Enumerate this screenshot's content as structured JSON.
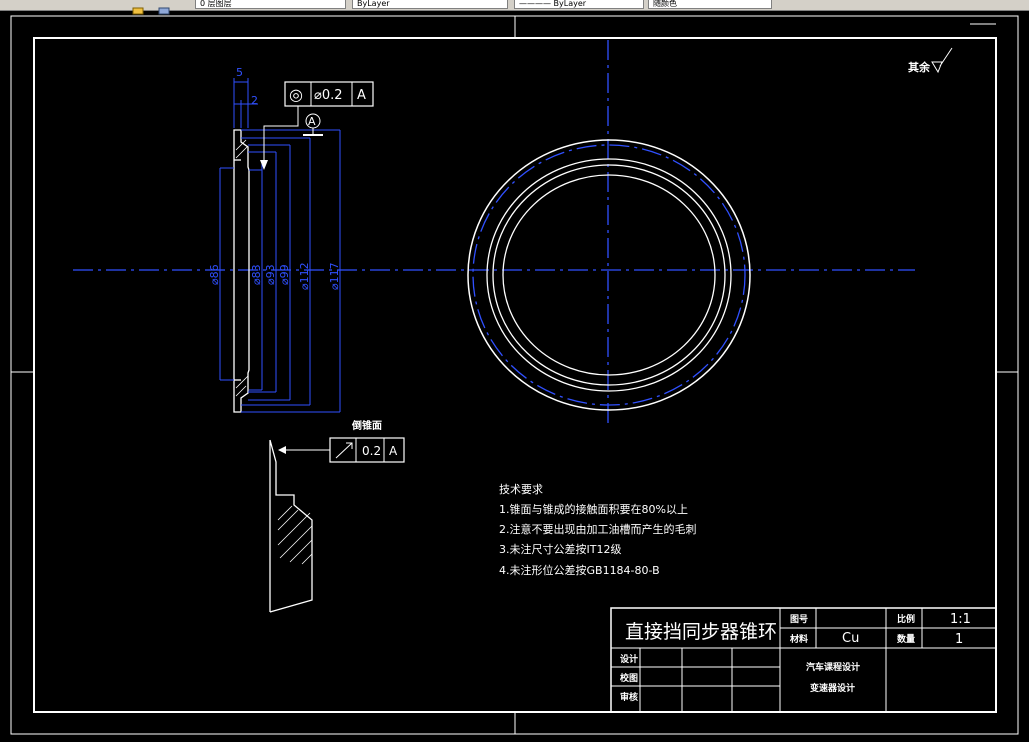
{
  "toolbar": {
    "layer_value": "0 层图层",
    "color_value": "ByLayer",
    "linetype_value": "———— ByLayer",
    "lineweight_value": "随颜色"
  },
  "drawing": {
    "roughness_other": "其余",
    "dimensions": {
      "top_width": "5",
      "top_step": "2",
      "d86": "⌀86",
      "d83": "⌀83",
      "d93": "⌀93",
      "d99": "⌀99",
      "d112": "⌀112",
      "d117": "⌀117"
    },
    "tolerance_concentricity": {
      "symbol": "◎",
      "value": "⌀0.2",
      "datum": "A"
    },
    "datum_label": "A",
    "section_title": "倒锥面",
    "tolerance_runout": {
      "symbol": "↗",
      "value": "0.2",
      "datum": "A"
    }
  },
  "requirements": {
    "title": "技术要求",
    "items": [
      "1.锥面与锥成的接触面积要在80%以上",
      "2.注意不要出现由加工油槽而产生的毛刺",
      "3.未注尺寸公差按IT12级",
      "4.未注形位公差按GB1184-80-B"
    ]
  },
  "title_block": {
    "part_name": "直接挡同步器锥环",
    "drawing_no_label": "图号",
    "scale_label": "比例",
    "scale_value": "1:1",
    "material_label": "材料",
    "material_value": "Cu",
    "quantity_label": "数量",
    "quantity_value": "1",
    "designer_label": "设计",
    "checker_label": "校图",
    "audit_label": "审核",
    "course": "汽车课程设计",
    "project": "变速器设计"
  }
}
